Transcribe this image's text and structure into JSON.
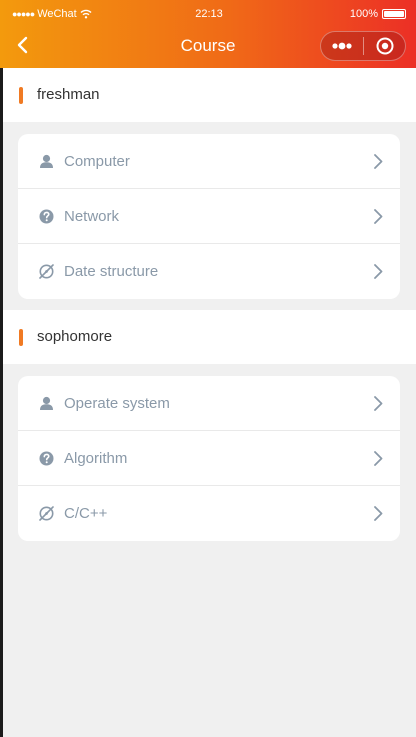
{
  "status_bar": {
    "carrier": "WeChat",
    "time": "22:13",
    "battery": "100%"
  },
  "header": {
    "title": "Course"
  },
  "sections": [
    {
      "title": "freshman",
      "items": [
        {
          "label": "Computer",
          "icon": "person-icon"
        },
        {
          "label": "Network",
          "icon": "question-icon"
        },
        {
          "label": "Date structure",
          "icon": "compass-slash-icon"
        }
      ]
    },
    {
      "title": "sophomore",
      "items": [
        {
          "label": "Operate system",
          "icon": "person-icon"
        },
        {
          "label": "Algorithm",
          "icon": "question-icon"
        },
        {
          "label": "C/C++",
          "icon": "compass-slash-icon"
        }
      ]
    }
  ],
  "colors": {
    "accent": "#f07a23",
    "header_gradient_start": "#f39a0d",
    "header_gradient_end": "#ec2f26",
    "item_text": "#8a99a8",
    "background": "#f0f0f0"
  }
}
